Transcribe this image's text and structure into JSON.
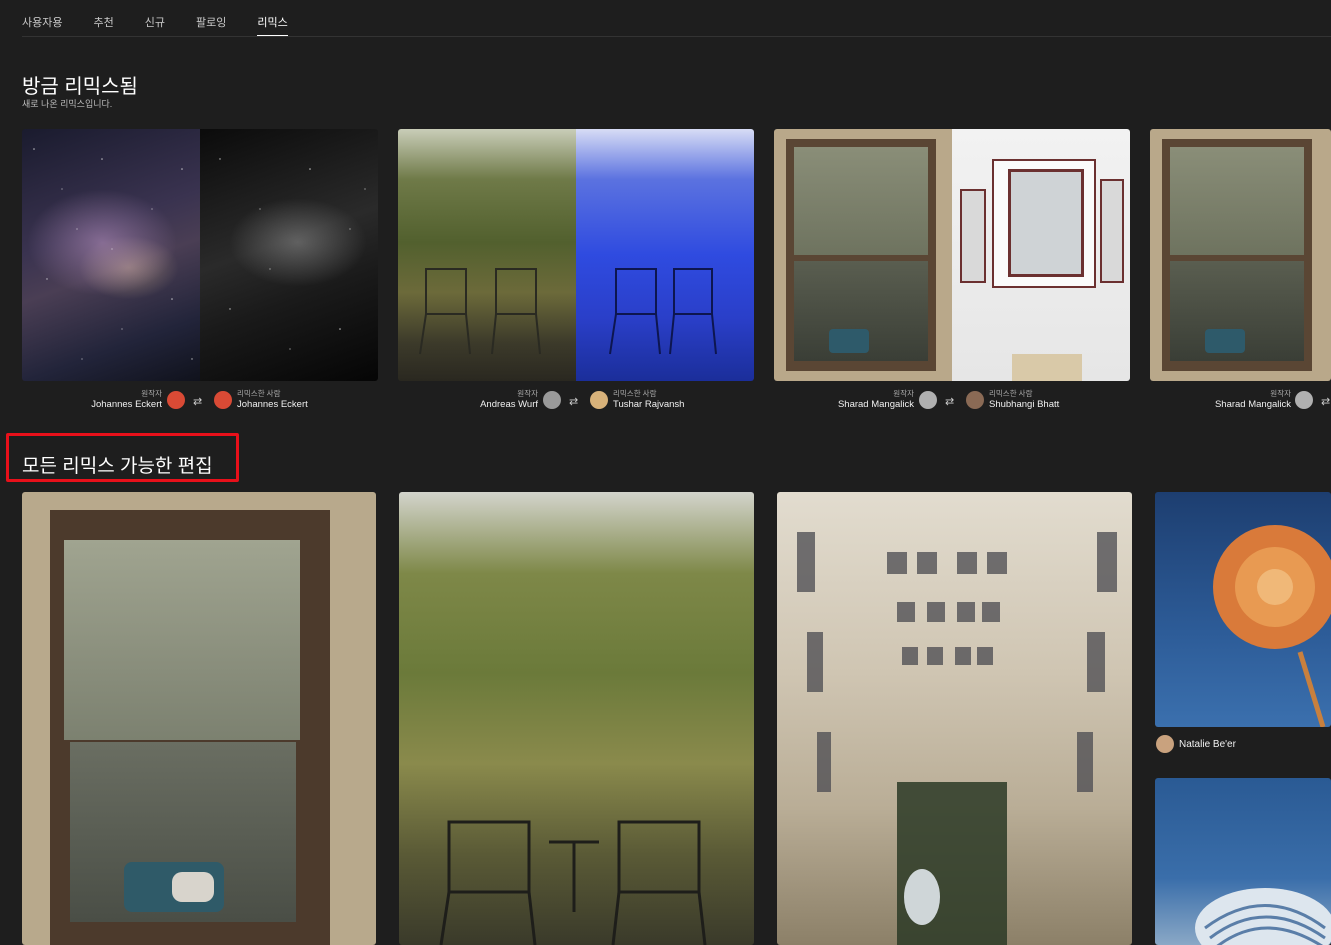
{
  "tabs": [
    {
      "label": "사용자용"
    },
    {
      "label": "추천"
    },
    {
      "label": "신규"
    },
    {
      "label": "팔로잉"
    },
    {
      "label": "리믹스"
    }
  ],
  "active_tab": "리믹스",
  "recent_section": {
    "title": "방금 리믹스됨",
    "subtitle": "새로 나온 리믹스입니다."
  },
  "remix_cards": [
    {
      "original_role": "원작자",
      "original_name": "Johannes Eckert",
      "remixer_role": "리믹스한 사람",
      "remixer_name": "Johannes Eckert"
    },
    {
      "original_role": "원작자",
      "original_name": "Andreas Wurf",
      "remixer_role": "리믹스한 사람",
      "remixer_name": "Tushar Rajvansh"
    },
    {
      "original_role": "원작자",
      "original_name": "Sharad Mangalick",
      "remixer_role": "리믹스한 사람",
      "remixer_name": "Shubhangi Bhatt"
    },
    {
      "original_role": "원작자",
      "original_name": "Sharad Mangalick"
    }
  ],
  "all_section": {
    "title": "모든 리믹스 가능한 편집"
  },
  "grid_tiles": [
    {
      "author": ""
    },
    {
      "author": ""
    },
    {
      "author": ""
    },
    {
      "author": "Natalie Be'er"
    },
    {
      "author": ""
    }
  ],
  "colors": {
    "background": "#1e1e1e",
    "highlight_border": "#e8101a",
    "text_primary": "#ffffff"
  }
}
